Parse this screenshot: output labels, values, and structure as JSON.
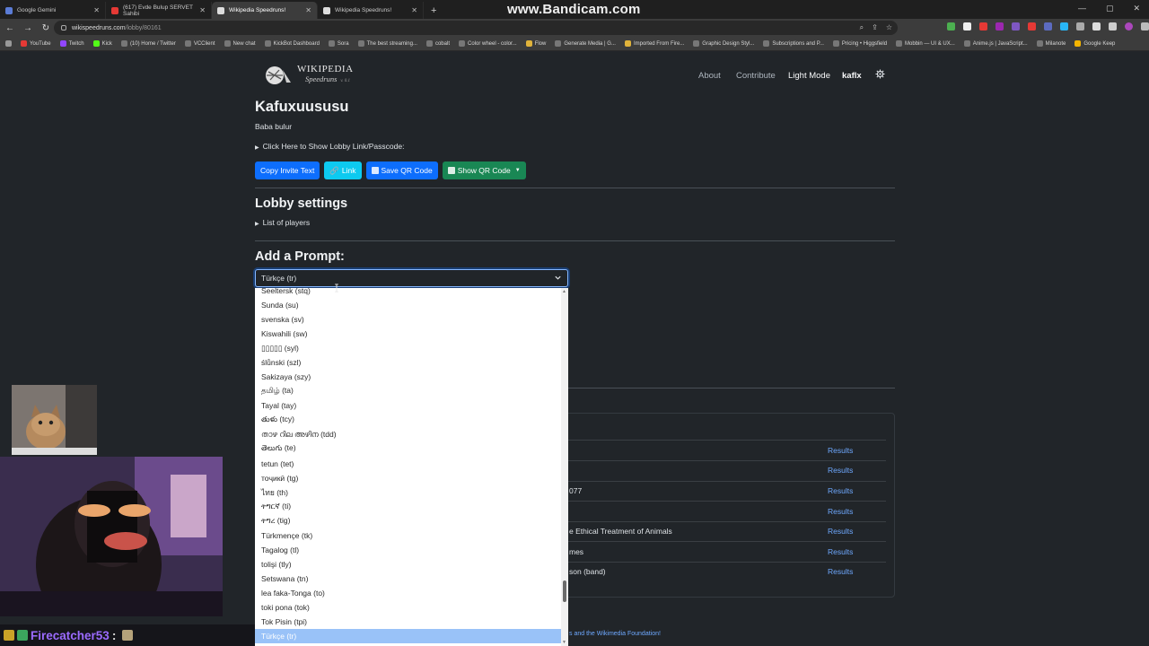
{
  "browser": {
    "tabs": [
      {
        "title": "Google Gemini",
        "icon": "gemini-icon",
        "active": false
      },
      {
        "title": "(617) Evde Bulup SERVET Sahibi",
        "icon": "youtube-icon",
        "active": false
      },
      {
        "title": "Wikipedia Speedruns!",
        "icon": "wikipedia-icon",
        "active": true
      },
      {
        "title": "Wikipedia Speedruns!",
        "icon": "wikipedia-icon",
        "active": false
      }
    ],
    "watermark": "www.Bandicam.com",
    "url_host": "wikispeedruns.com",
    "url_path": "/lobby/80161",
    "bookmarks": [
      "YouTube",
      "Twitch",
      "Kick",
      "(10) Home / Twitter",
      "VCClient",
      "New chat",
      "KickBot Dashboard",
      "Sora",
      "The best streaming...",
      "cobalt",
      "Color wheel - color...",
      "Flow",
      "Generate Media | G...",
      "Imported From Fire...",
      "Graphic Design Styl...",
      "Subscriptions and P...",
      "Pricing • Higgsfield",
      "Mobbin — UI & UX...",
      "Anime.js | JavaScript...",
      "Milanote",
      "Google Keep"
    ]
  },
  "site": {
    "logo_wordmark": "WIKIPEDIA",
    "logo_sub": "Speedruns",
    "logo_version": "v. 0.1",
    "nav": {
      "about": "About",
      "contribute": "Contribute",
      "theme": "Light Mode",
      "user": "kaflx"
    }
  },
  "lobby": {
    "name": "Kafuxuususu",
    "description": "Baba bulur",
    "show_link_toggle": "Click Here to Show Lobby Link/Passcode:",
    "buttons": {
      "copy_invite": "Copy Invite Text",
      "link": "Link",
      "save_qr": "Save QR Code",
      "show_qr": "Show QR Code"
    },
    "settings_heading": "Lobby settings",
    "players_toggle": "List of players",
    "prompt_heading": "Add a Prompt:",
    "language_select": {
      "selected": "Türkçe (tr)",
      "options": [
        "Seeltersk (stq)",
        "Sunda (su)",
        "svenska (sv)",
        "Kiswahili (sw)",
        "▯▯▯▯▯ (syl)",
        "ślůnski (szl)",
        "Sakizaya (szy)",
        "தமிழ் (ta)",
        "Tayal (tay)",
        "తుళు (tcy)",
        "താഴ റില അഴിന (tdd)",
        "తెలుగు (te)",
        "tetun (tet)",
        "тоҷикӣ (tg)",
        "ไทย (th)",
        "ትግርኛ (ti)",
        "ትግረ (tig)",
        "Türkmençe (tk)",
        "Tagalog (tl)",
        "tolişi (tly)",
        "Setswana (tn)",
        "lea faka-Tonga (to)",
        "toki pona (tok)",
        "Tok Pisin (tpi)",
        "Türkçe (tr)"
      ]
    }
  },
  "prompts_table": {
    "visible_fragments": [
      "077",
      "e Ethical Treatment of Animals",
      "mes",
      "son (band)"
    ],
    "results_label": "Results",
    "row_count": 7
  },
  "footer_fragment": "s and the Wikimedia Foundation!",
  "overlay": {
    "chat_user": "Firecatcher53",
    "chat_sep": ":"
  },
  "colors": {
    "page_bg": "#212529",
    "primary": "#0d6efd",
    "info": "#0dcaf0",
    "success": "#198754",
    "link": "#6ea8fe",
    "select_highlight": "#99c2f8",
    "chat_name": "#9b6bff"
  }
}
